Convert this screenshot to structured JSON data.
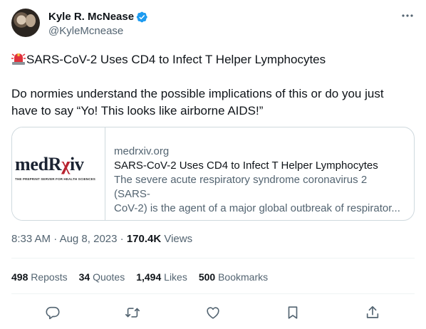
{
  "author": {
    "name": "Kyle R. McNease",
    "handle": "@KyleMcnease",
    "verified_color": "#1d9bf0"
  },
  "tweet": {
    "line1": "SARS-CoV-2 Uses CD4 to Infect T Helper Lymphocytes",
    "line1_icon": "siren-emoji",
    "line2": "Do normies understand the possible implications of this or do you just",
    "line3": "have to say “Yo! This looks like airborne AIDS!”"
  },
  "card": {
    "logo_main": "medR",
    "logo_rx": "χ",
    "logo_end": "iv",
    "logo_tagline": "THE PREPRINT SERVER FOR HEALTH SCIENCES",
    "domain": "medrxiv.org",
    "title": "SARS-CoV-2 Uses CD4 to Infect T Helper Lymphocytes",
    "desc_line1": "The severe acute respiratory syndrome coronavirus 2 (SARS-",
    "desc_line2": "CoV-2) is the agent of a major global outbreak of respirator..."
  },
  "meta": {
    "time": "8:33 AM",
    "sep1": " · ",
    "date": "Aug 8, 2023",
    "sep2": " · ",
    "views_count": "170.4K",
    "views_label": " Views"
  },
  "stats": {
    "reposts_count": "498",
    "reposts_label": "Reposts",
    "quotes_count": "34",
    "quotes_label": "Quotes",
    "likes_count": "1,494",
    "likes_label": "Likes",
    "bookmarks_count": "500",
    "bookmarks_label": "Bookmarks"
  },
  "actions": [
    "reply-icon",
    "repost-icon",
    "like-icon",
    "bookmark-icon",
    "share-icon"
  ],
  "colors": {
    "text": "#0f1419",
    "secondary": "#536471",
    "border": "#cfd9de",
    "accent": "#1d9bf0"
  }
}
